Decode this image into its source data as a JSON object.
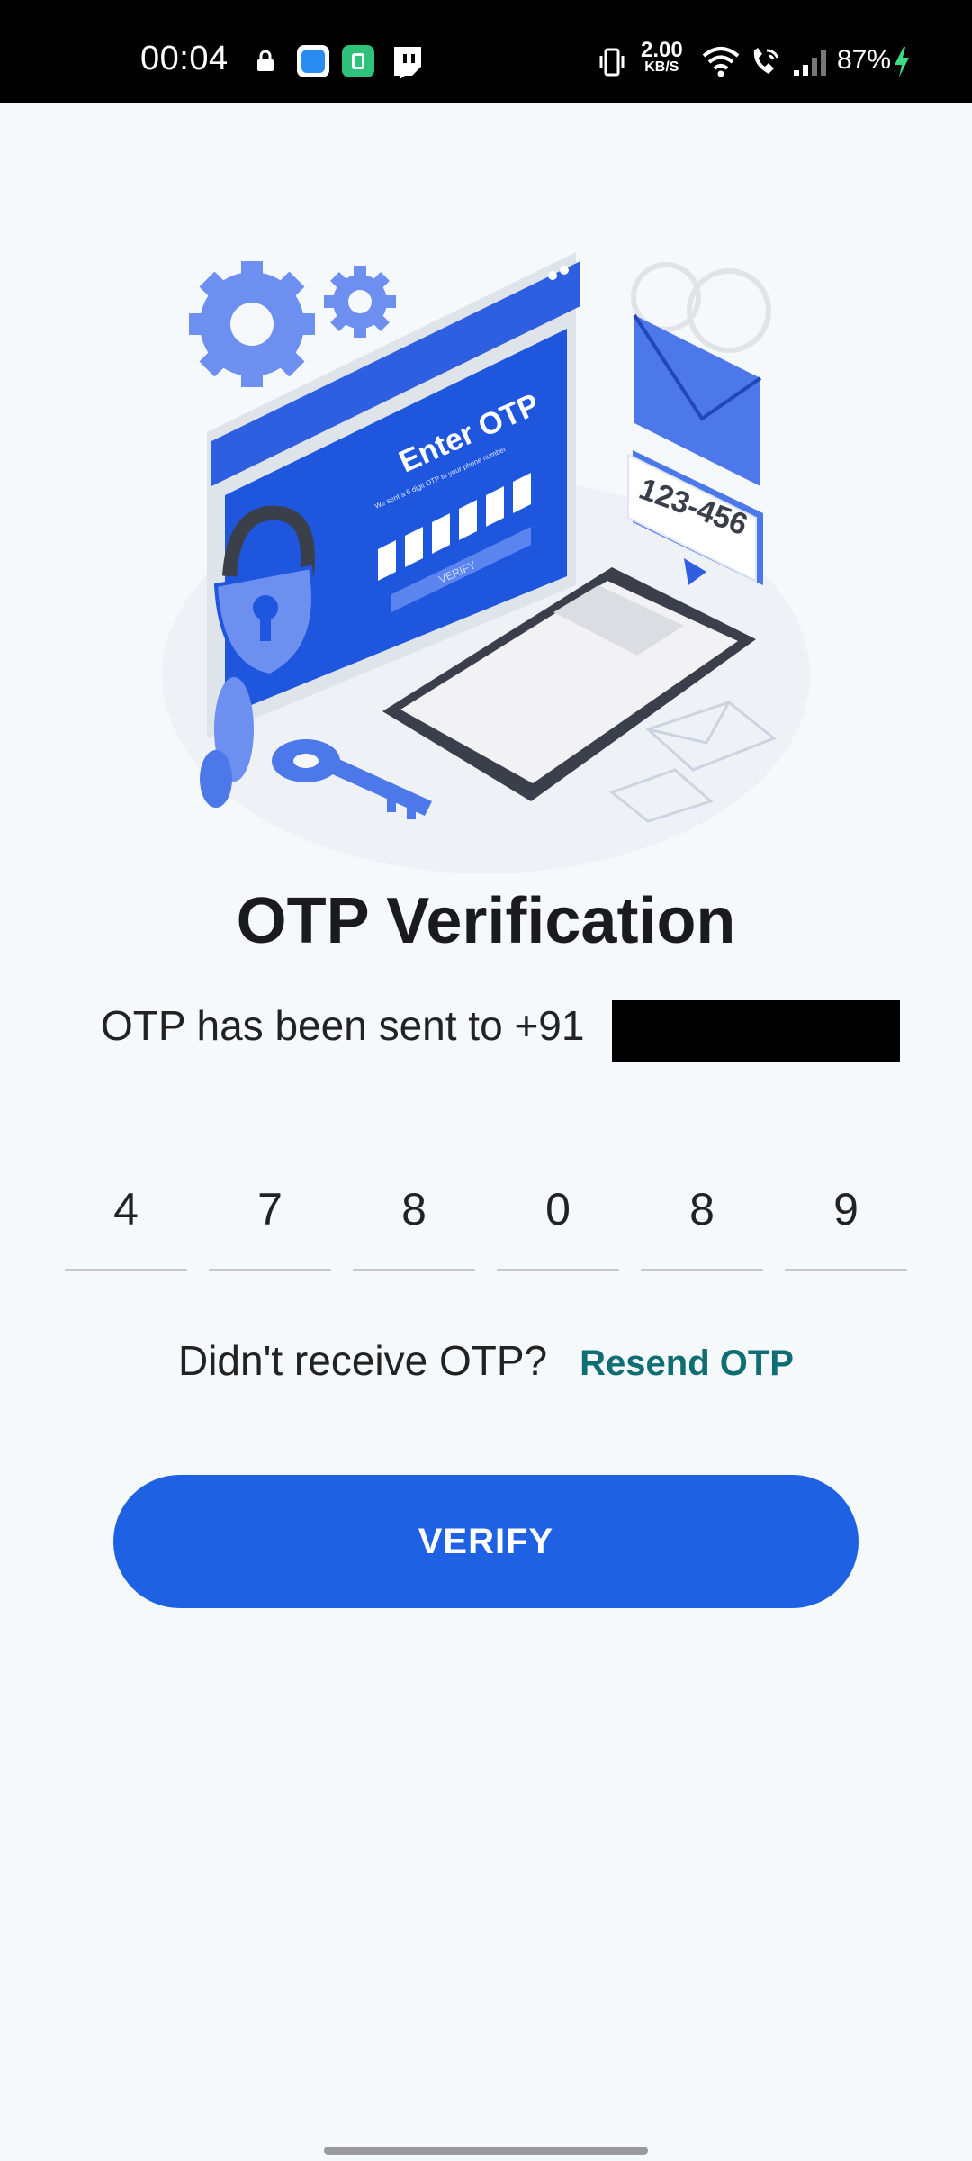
{
  "status_bar": {
    "time": "00:04",
    "speed_value": "2.00",
    "speed_unit": "KB/S",
    "battery": "87%",
    "icons": [
      "lock-icon",
      "app-blue-icon",
      "app-green-icon",
      "twitch-icon",
      "vibrate-icon",
      "wifi-icon",
      "wifi-call-icon",
      "signal-icon",
      "charging-icon"
    ]
  },
  "illustration": {
    "screen_title": "Enter OTP",
    "screen_subtitle": "We sent a 6 digit OTP to your phone number",
    "screen_button": "VERIFY",
    "sms_code": "123-456"
  },
  "page": {
    "title": "OTP Verification",
    "subtitle": "OTP has been sent to +91"
  },
  "otp": {
    "digits": [
      "4",
      "7",
      "8",
      "0",
      "8",
      "9"
    ]
  },
  "resend": {
    "question": "Didn't receive OTP?",
    "link": "Resend OTP"
  },
  "actions": {
    "verify": "VERIFY"
  },
  "colors": {
    "primary": "#1f61e3",
    "link": "#0f6e72",
    "background": "#f5f9fc"
  }
}
